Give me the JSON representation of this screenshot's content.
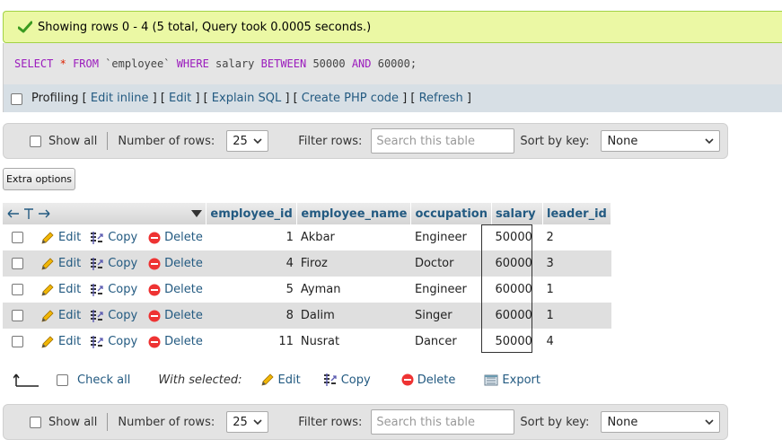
{
  "success_message": "Showing rows 0 - 4 (5 total, Query took 0.0005 seconds.)",
  "sql": {
    "select": "SELECT",
    "star": "*",
    "from": "FROM",
    "table": "`employee`",
    "where": "WHERE",
    "column": "salary",
    "between": "BETWEEN",
    "low": "50000",
    "and": "AND",
    "high": "60000;"
  },
  "profiling": {
    "label": "Profiling",
    "links": [
      "Edit inline",
      "Edit",
      "Explain SQL",
      "Create PHP code",
      "Refresh"
    ]
  },
  "nav": {
    "show_all": "Show all",
    "num_rows_label": "Number of rows:",
    "num_rows_value": "25",
    "filter_label": "Filter rows:",
    "filter_placeholder": "Search this table",
    "sort_label": "Sort by key:",
    "sort_value": "None"
  },
  "extra_options": "Extra options",
  "table": {
    "columns": [
      "employee_id",
      "employee_name",
      "occupation",
      "salary",
      "leader_id"
    ],
    "actions": {
      "edit": "Edit",
      "copy": "Copy",
      "delete": "Delete"
    },
    "rows": [
      {
        "employee_id": "1",
        "employee_name": "Akbar",
        "occupation": "Engineer",
        "salary": "50000",
        "leader_id": "2"
      },
      {
        "employee_id": "4",
        "employee_name": "Firoz",
        "occupation": "Doctor",
        "salary": "60000",
        "leader_id": "3"
      },
      {
        "employee_id": "5",
        "employee_name": "Ayman",
        "occupation": "Engineer",
        "salary": "60000",
        "leader_id": "1"
      },
      {
        "employee_id": "8",
        "employee_name": "Dalim",
        "occupation": "Singer",
        "salary": "60000",
        "leader_id": "1"
      },
      {
        "employee_id": "11",
        "employee_name": "Nusrat",
        "occupation": "Dancer",
        "salary": "50000",
        "leader_id": "4"
      }
    ]
  },
  "bulk": {
    "check_all": "Check all",
    "with_selected": "With selected:",
    "edit": "Edit",
    "copy": "Copy",
    "delete": "Delete",
    "export": "Export"
  },
  "colors": {
    "success_bg": "#ebf8a4",
    "link": "#235a81",
    "keyword": "#9b1bbd",
    "delete_red": "#e33"
  }
}
